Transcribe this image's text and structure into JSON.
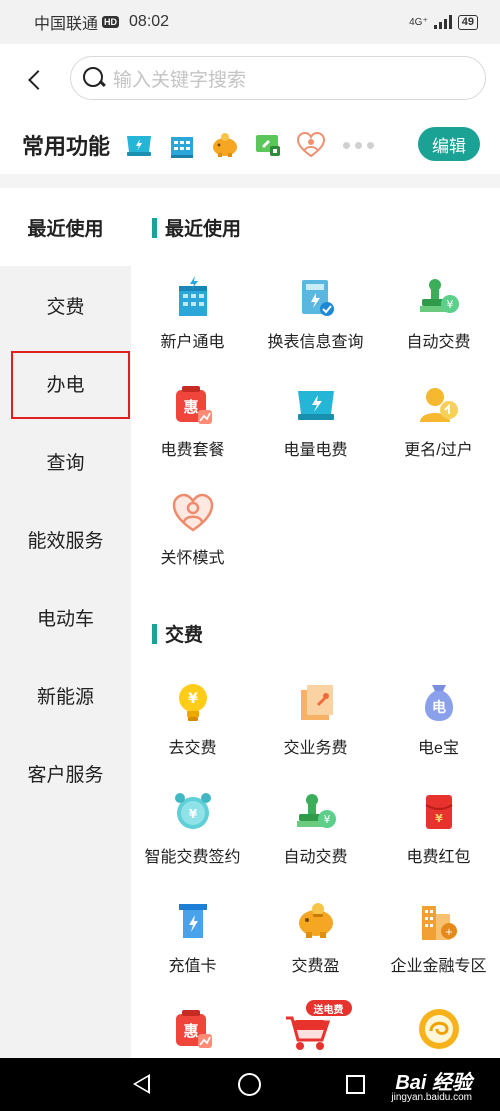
{
  "status_bar": {
    "carrier": "中国联通",
    "hd": "HD",
    "time": "08:02",
    "network": "4G⁺",
    "battery": "49"
  },
  "search": {
    "placeholder": "输入关键字搜索"
  },
  "common_functions": {
    "title": "常用功能",
    "icons": [
      "screen-power-icon",
      "building-icon",
      "piggy-bank-icon",
      "payment-card-icon",
      "heart-care-icon"
    ],
    "edit_label": "编辑"
  },
  "sidebar": {
    "items": [
      {
        "label": "最近使用",
        "active": true
      },
      {
        "label": "交费",
        "active": false
      },
      {
        "label": "办电",
        "active": false
      },
      {
        "label": "查询",
        "active": false
      },
      {
        "label": "能效服务",
        "active": false
      },
      {
        "label": "电动车",
        "active": false
      },
      {
        "label": "新能源",
        "active": false
      },
      {
        "label": "客户服务",
        "active": false
      }
    ]
  },
  "sections": [
    {
      "title": "最近使用",
      "items": [
        {
          "label": "新户通电",
          "icon": "building-icon"
        },
        {
          "label": "换表信息查询",
          "icon": "meter-check-icon"
        },
        {
          "label": "自动交费",
          "icon": "stamp-coin-icon"
        },
        {
          "label": "电费套餐",
          "icon": "discount-bag-icon"
        },
        {
          "label": "电量电费",
          "icon": "screen-power-icon"
        },
        {
          "label": "更名/过户",
          "icon": "user-transfer-icon"
        },
        {
          "label": "关怀模式",
          "icon": "heart-care-icon"
        }
      ]
    },
    {
      "title": "交费",
      "items": [
        {
          "label": "去交费",
          "icon": "bulb-yuan-icon"
        },
        {
          "label": "交业务费",
          "icon": "document-pin-icon"
        },
        {
          "label": "电e宝",
          "icon": "money-bag-icon"
        },
        {
          "label": "智能交费签约",
          "icon": "alarm-clock-icon"
        },
        {
          "label": "自动交费",
          "icon": "stamp-coin-icon"
        },
        {
          "label": "电费红包",
          "icon": "red-envelope-icon"
        },
        {
          "label": "充值卡",
          "icon": "recharge-card-icon"
        },
        {
          "label": "交费盈",
          "icon": "piggy-bank-icon"
        },
        {
          "label": "企业金融专区",
          "icon": "enterprise-building-icon"
        },
        {
          "label": "",
          "icon": "discount-bag-icon"
        },
        {
          "label": "",
          "icon": "shopping-cart-icon",
          "badge": "送电费"
        },
        {
          "label": "",
          "icon": "gold-coin-icon"
        }
      ]
    }
  ],
  "colors": {
    "accent": "#1aa294",
    "highlight_box": "#e02020"
  },
  "watermark": {
    "brand": "Bai 经验",
    "url": "jingyan.baidu.com"
  }
}
